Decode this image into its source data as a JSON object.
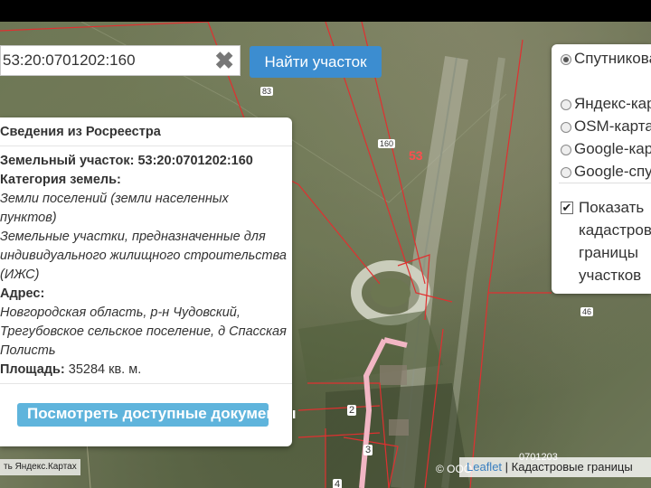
{
  "search": {
    "value": "53:20:0701202:160",
    "clear_icon": "close-icon",
    "find_label": "Найти участок"
  },
  "info": {
    "title": "Сведения из Росреестра",
    "parcel_label": "Земельный участок:",
    "parcel_value": "53:20:0701202:160",
    "category_label": "Категория земель:",
    "category_value": "Земли поселений (земли населенных пунктов)",
    "use_value": "Земельные участки, предназначенные для индивидуального жилищного строительства (ИЖС)",
    "address_label": "Адрес:",
    "address_value": "Новгородская область, р-н Чудовский, Трегубовское сельское поселение, д Спасская Полисть",
    "area_label": "Площадь:",
    "area_value": "35284 кв. м.",
    "docs_button": "Посмотреть доступные документы"
  },
  "layers": {
    "options": [
      {
        "label": "Спутниковая карта",
        "selected": true
      },
      {
        "label": "Яндекс-карта",
        "selected": false
      },
      {
        "label": "OSM-карта",
        "selected": false
      },
      {
        "label": "Google-карта",
        "selected": false
      },
      {
        "label": "Google-спутник",
        "selected": false
      }
    ],
    "overlay_label": "Показать кадастровые границы участков",
    "overlay_checked": true
  },
  "map_labels": {
    "l83": "83",
    "l160": "160",
    "l53": "53",
    "l46": "46",
    "l2": "2",
    "l3": "3",
    "l4": "4",
    "l0701203": "0701203"
  },
  "attribution": {
    "left": "ть   Яндекс.Картах",
    "copyright": "© ООО",
    "leaflet": "Leaflet",
    "right_text": "| Кадастровые границы"
  }
}
